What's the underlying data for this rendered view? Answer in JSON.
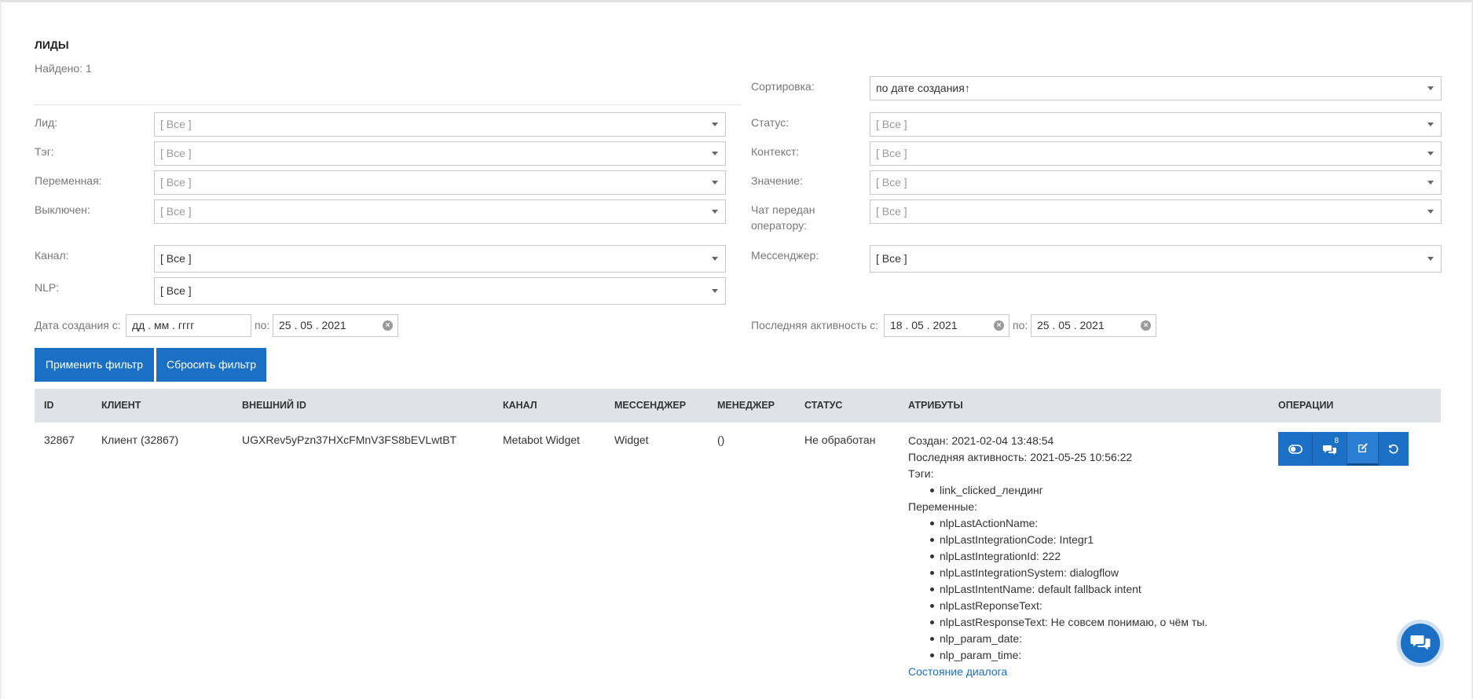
{
  "page": {
    "title": "ЛИДЫ",
    "found": "Найдено: 1"
  },
  "sort": {
    "label": "Сортировка:",
    "value": "по дате создания↑"
  },
  "filters": {
    "lead": {
      "label": "Лид:",
      "value": "[ Все ]"
    },
    "tag": {
      "label": "Тэг:",
      "value": "[ Все ]"
    },
    "variable": {
      "label": "Переменная:",
      "value": "[ Все ]"
    },
    "disabled": {
      "label": "Выключен:",
      "value": "[ Все ]"
    },
    "channel": {
      "label": "Канал:",
      "value": "[ Все ]"
    },
    "nlp": {
      "label": "NLP:",
      "value": "[ Все ]"
    },
    "status": {
      "label": "Статус:",
      "value": "[ Все ]"
    },
    "context": {
      "label": "Контекст:",
      "value": "[ Все ]"
    },
    "value": {
      "label": "Значение:",
      "value": "[ Все ]"
    },
    "operator": {
      "label_line1": "Чат передан",
      "label_line2": "оператору:",
      "value": "[ Все ]"
    },
    "messenger": {
      "label": "Мессенджер:",
      "value": "[ Все ]"
    }
  },
  "dates": {
    "created_label": "Дата создания с:",
    "created_from": "дд . мм . гггг",
    "created_to_label": "по:",
    "created_to": "25 . 05 . 2021",
    "activity_label": "Последняя активность с:",
    "activity_from": "18 . 05 . 2021",
    "activity_to_label": "по:",
    "activity_to": "25 . 05 . 2021"
  },
  "buttons": {
    "apply": "Применить фильтр",
    "reset": "Сбросить фильтр"
  },
  "table": {
    "headers": {
      "id": "ID",
      "client": "КЛИЕНТ",
      "external_id": "ВНЕШНИЙ ID",
      "channel": "КАНАЛ",
      "messenger": "МЕССЕНДЖЕР",
      "manager": "МЕНЕДЖЕР",
      "status": "СТАТУС",
      "attributes": "АТРИБУТЫ",
      "operations": "ОПЕРАЦИИ"
    },
    "row": {
      "id": "32867",
      "client": "Клиент (32867)",
      "external_id": "UGXRev5yPzn37HXcFMnV3FS8bEVLwtBT",
      "channel": "Metabot Widget",
      "messenger": "Widget",
      "manager": "()",
      "status": "Не обработан",
      "created": "Создан: 2021-02-04 13:48:54",
      "last_activity": "Последняя активность: 2021-05-25 10:56:22",
      "tags_label": "Тэги:",
      "tags": [
        "link_clicked_лендинг"
      ],
      "vars_label": "Переменные:",
      "vars": [
        "nlpLastActionName:",
        "nlpLastIntegrationCode: Integr1",
        "nlpLastIntegrationId: 222",
        "nlpLastIntegrationSystem: dialogflow",
        "nlpLastIntentName: default fallback intent",
        "nlpLastReponseText:",
        "nlpLastResponseText: Не совсем понимаю, о чём ты.",
        "nlp_param_date:",
        "nlp_param_time:"
      ],
      "dialog_state_link": "Состояние диалога",
      "messages_count": "8"
    }
  },
  "icons": {
    "toggle": "toggle-icon",
    "comments": "comments-icon",
    "edit": "edit-icon",
    "reset": "undo-icon",
    "chat": "chat-icon"
  },
  "colors": {
    "accent": "#1b6fc4",
    "table_header": "#dfe3e8"
  }
}
